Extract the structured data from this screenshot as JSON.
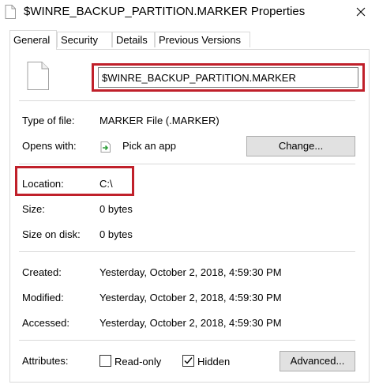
{
  "window": {
    "title": "$WINRE_BACKUP_PARTITION.MARKER Properties",
    "close_glyph": "✕"
  },
  "tabs": [
    {
      "label": "General",
      "active": true
    },
    {
      "label": "Security",
      "active": false
    },
    {
      "label": "Details",
      "active": false
    },
    {
      "label": "Previous Versions",
      "active": false
    }
  ],
  "general": {
    "file_name": "$WINRE_BACKUP_PARTITION.MARKER",
    "type_label": "Type of file:",
    "type_value": "MARKER File (.MARKER)",
    "opens_label": "Opens with:",
    "opens_value": "Pick an app",
    "change_button": "Change...",
    "location_label": "Location:",
    "location_value": "C:\\",
    "size_label": "Size:",
    "size_value": "0 bytes",
    "size_on_disk_label": "Size on disk:",
    "size_on_disk_value": "0 bytes",
    "created_label": "Created:",
    "created_value": "Yesterday, October 2, 2018, 4:59:30 PM",
    "modified_label": "Modified:",
    "modified_value": "Yesterday, October 2, 2018, 4:59:30 PM",
    "accessed_label": "Accessed:",
    "accessed_value": "Yesterday, October 2, 2018, 4:59:30 PM",
    "attributes_label": "Attributes:",
    "readonly_label": "Read-only",
    "readonly_checked": false,
    "hidden_label": "Hidden",
    "hidden_checked": true,
    "advanced_button": "Advanced..."
  },
  "colors": {
    "highlight": "#c0202a",
    "separator": "#d9d9d9",
    "button_bg": "#e1e1e1",
    "app_icon_green": "#2e9e3a"
  }
}
